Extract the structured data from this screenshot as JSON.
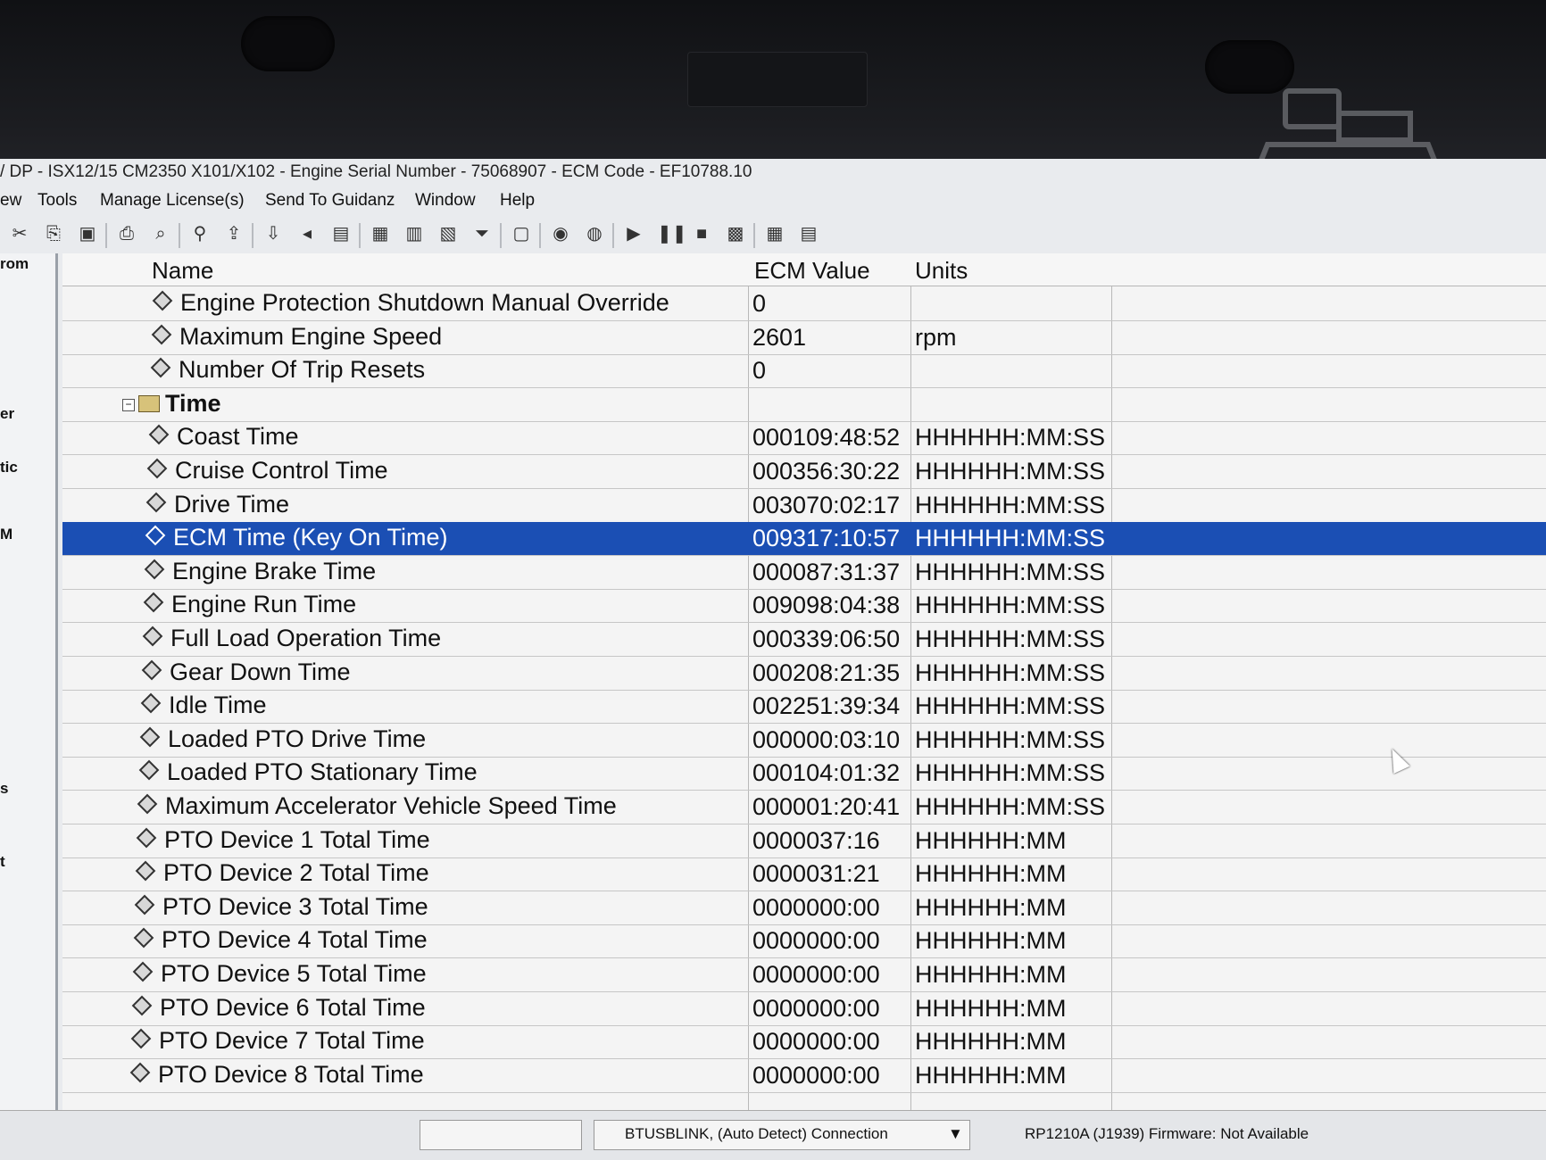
{
  "window": {
    "title": "/ DP - ISX12/15 CM2350 X101/X102 - Engine Serial Number - 75068907 - ECM Code - EF10788.10"
  },
  "menu": [
    "ew",
    "Tools",
    "Manage License(s)",
    "Send To Guidanz",
    "Window",
    "Help"
  ],
  "left_panel": [
    "rom",
    "er",
    "tic",
    "M",
    "s",
    "t"
  ],
  "grid": {
    "columns": [
      "Name",
      "ECM Value",
      "Units"
    ],
    "rows": [
      {
        "name": "Engine Protection Shutdown Manual Override",
        "value": "0",
        "units": ""
      },
      {
        "name": "Maximum Engine Speed",
        "value": "2601",
        "units": "rpm"
      },
      {
        "name": "Number Of Trip Resets",
        "value": "0",
        "units": ""
      },
      {
        "name": "Time",
        "value": "",
        "units": "",
        "group": true
      },
      {
        "name": "Coast Time",
        "value": "000109:48:52",
        "units": "HHHHHH:MM:SS"
      },
      {
        "name": "Cruise Control Time",
        "value": "000356:30:22",
        "units": "HHHHHH:MM:SS"
      },
      {
        "name": "Drive Time",
        "value": "003070:02:17",
        "units": "HHHHHH:MM:SS"
      },
      {
        "name": "ECM Time (Key On Time)",
        "value": "009317:10:57",
        "units": "HHHHHH:MM:SS",
        "selected": true
      },
      {
        "name": "Engine Brake Time",
        "value": "000087:31:37",
        "units": "HHHHHH:MM:SS"
      },
      {
        "name": "Engine Run Time",
        "value": "009098:04:38",
        "units": "HHHHHH:MM:SS"
      },
      {
        "name": "Full Load Operation Time",
        "value": "000339:06:50",
        "units": "HHHHHH:MM:SS"
      },
      {
        "name": "Gear Down Time",
        "value": "000208:21:35",
        "units": "HHHHHH:MM:SS"
      },
      {
        "name": "Idle Time",
        "value": "002251:39:34",
        "units": "HHHHHH:MM:SS"
      },
      {
        "name": "Loaded PTO Drive Time",
        "value": "000000:03:10",
        "units": "HHHHHH:MM:SS"
      },
      {
        "name": "Loaded PTO Stationary Time",
        "value": "000104:01:32",
        "units": "HHHHHH:MM:SS"
      },
      {
        "name": "Maximum Accelerator Vehicle Speed Time",
        "value": "000001:20:41",
        "units": "HHHHHH:MM:SS"
      },
      {
        "name": "PTO Device 1 Total Time",
        "value": "0000037:16",
        "units": "HHHHHH:MM"
      },
      {
        "name": "PTO Device 2 Total Time",
        "value": "0000031:21",
        "units": "HHHHHH:MM"
      },
      {
        "name": "PTO Device 3 Total Time",
        "value": "0000000:00",
        "units": "HHHHHH:MM"
      },
      {
        "name": "PTO Device 4 Total Time",
        "value": "0000000:00",
        "units": "HHHHHH:MM"
      },
      {
        "name": "PTO Device 5 Total Time",
        "value": "0000000:00",
        "units": "HHHHHH:MM"
      },
      {
        "name": "PTO Device 6 Total Time",
        "value": "0000000:00",
        "units": "HHHHHH:MM"
      },
      {
        "name": "PTO Device 7 Total Time",
        "value": "0000000:00",
        "units": "HHHHHH:MM"
      },
      {
        "name": "PTO Device 8 Total Time",
        "value": "0000000:00",
        "units": "HHHHHH:MM"
      }
    ]
  },
  "statusbar": {
    "connection": "BTUSBLINK, (Auto Detect) Connection",
    "adapter": "RP1210A (J1939)  Firmware: Not Available"
  },
  "colors": {
    "selection": "#1b4fb4",
    "grid_bg": "#f4f4f4"
  },
  "toolbar_icons": [
    "cut-icon",
    "copy-icon",
    "paste-icon",
    "print-icon",
    "print-preview-icon",
    "find-icon",
    "import-icon",
    "export-icon",
    "back-icon",
    "report-icon",
    "save-icon",
    "page-icon",
    "page2-icon",
    "filter-icon",
    "window-icon",
    "camera-icon",
    "record-icon",
    "play-icon",
    "pause-icon",
    "stop-icon",
    "chart-icon",
    "calc-icon",
    "notes-icon"
  ]
}
